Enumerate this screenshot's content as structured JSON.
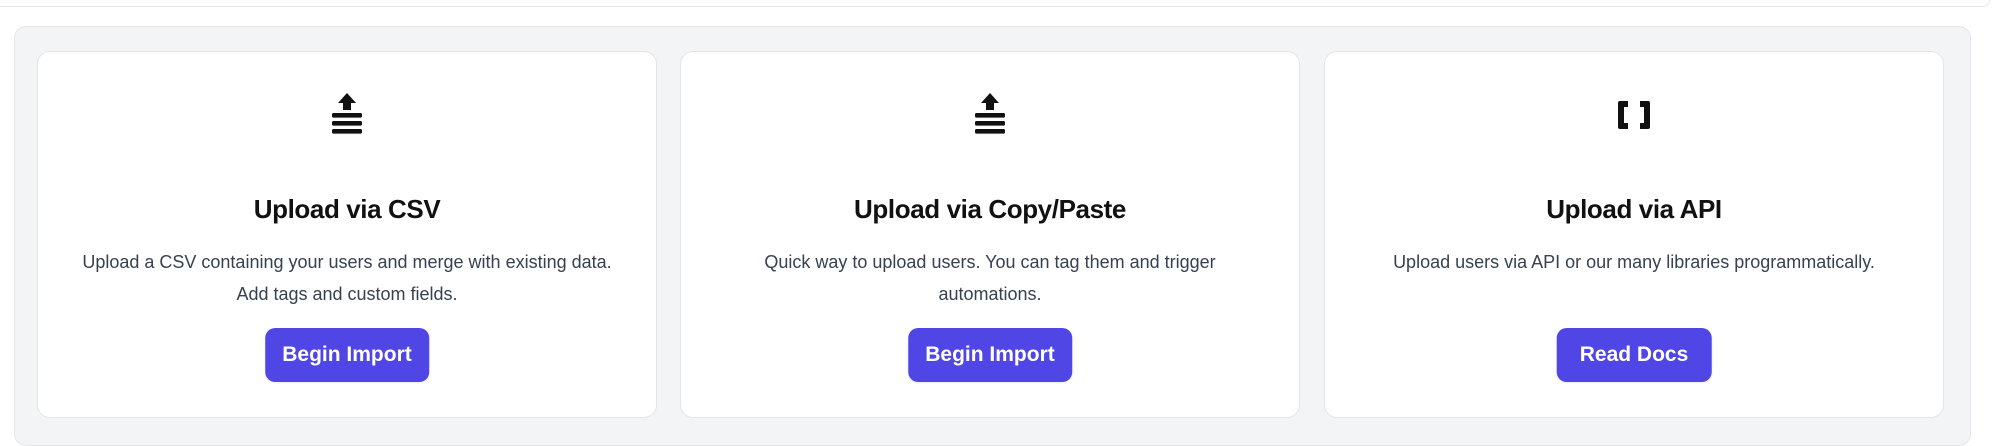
{
  "cards": [
    {
      "icon": "upload-stack-icon",
      "title": "Upload via CSV",
      "description": "Upload a CSV containing your users and merge with existing data. Add tags and custom fields.",
      "button_label": "Begin Import"
    },
    {
      "icon": "upload-stack-icon",
      "title": "Upload via Copy/Paste",
      "description": "Quick way to upload users. You can tag them and trigger automations.",
      "button_label": "Begin Import"
    },
    {
      "icon": "brackets-icon",
      "title": "Upload via API",
      "description": "Upload users via API or our many libraries programmatically.",
      "button_label": "Read Docs"
    }
  ],
  "colors": {
    "accent": "#4f46e5",
    "panel_background": "#f3f4f6",
    "card_background": "#ffffff",
    "title_text": "#111111",
    "body_text": "#374151"
  }
}
